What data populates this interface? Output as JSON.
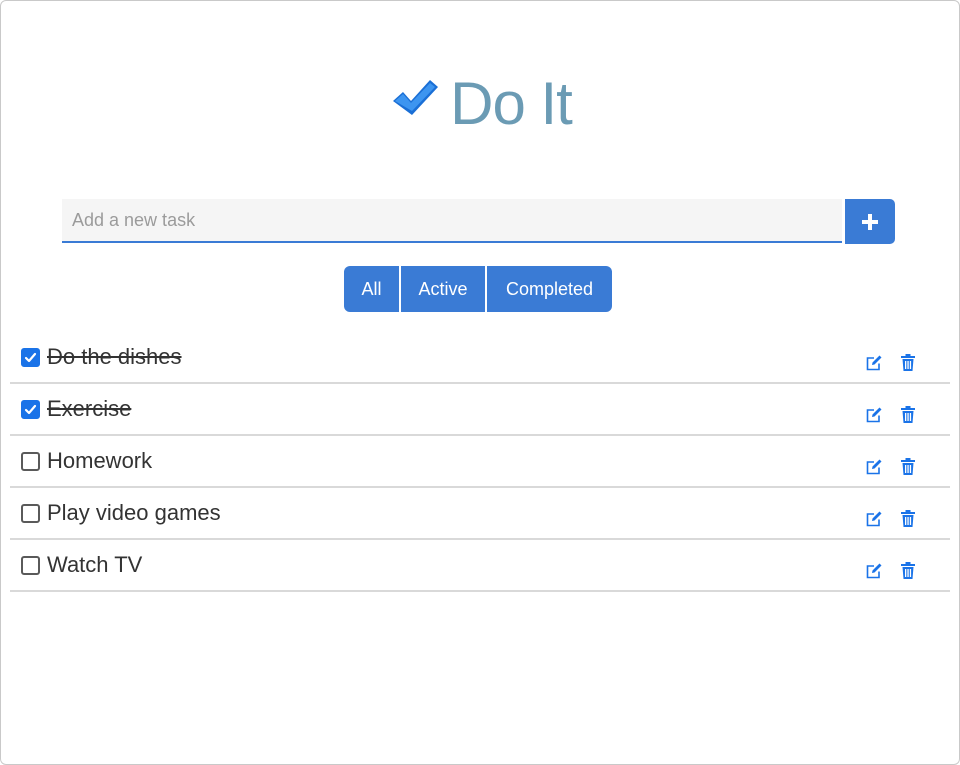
{
  "app": {
    "title": "Do It",
    "accent_color": "#3a7bd5",
    "title_color": "#6b9bb4",
    "logo_icon": "checkmark-icon"
  },
  "add_task": {
    "placeholder": "Add a new task",
    "value": "",
    "button_icon": "plus-icon"
  },
  "filters": [
    {
      "label": "All"
    },
    {
      "label": "Active"
    },
    {
      "label": "Completed"
    }
  ],
  "tasks": [
    {
      "text": "Do the dishes",
      "completed": true
    },
    {
      "text": "Exercise",
      "completed": true
    },
    {
      "text": "Homework",
      "completed": false
    },
    {
      "text": "Play video games",
      "completed": false
    },
    {
      "text": "Watch TV",
      "completed": false
    }
  ],
  "task_actions": {
    "edit_icon": "edit-icon",
    "delete_icon": "trash-icon"
  }
}
